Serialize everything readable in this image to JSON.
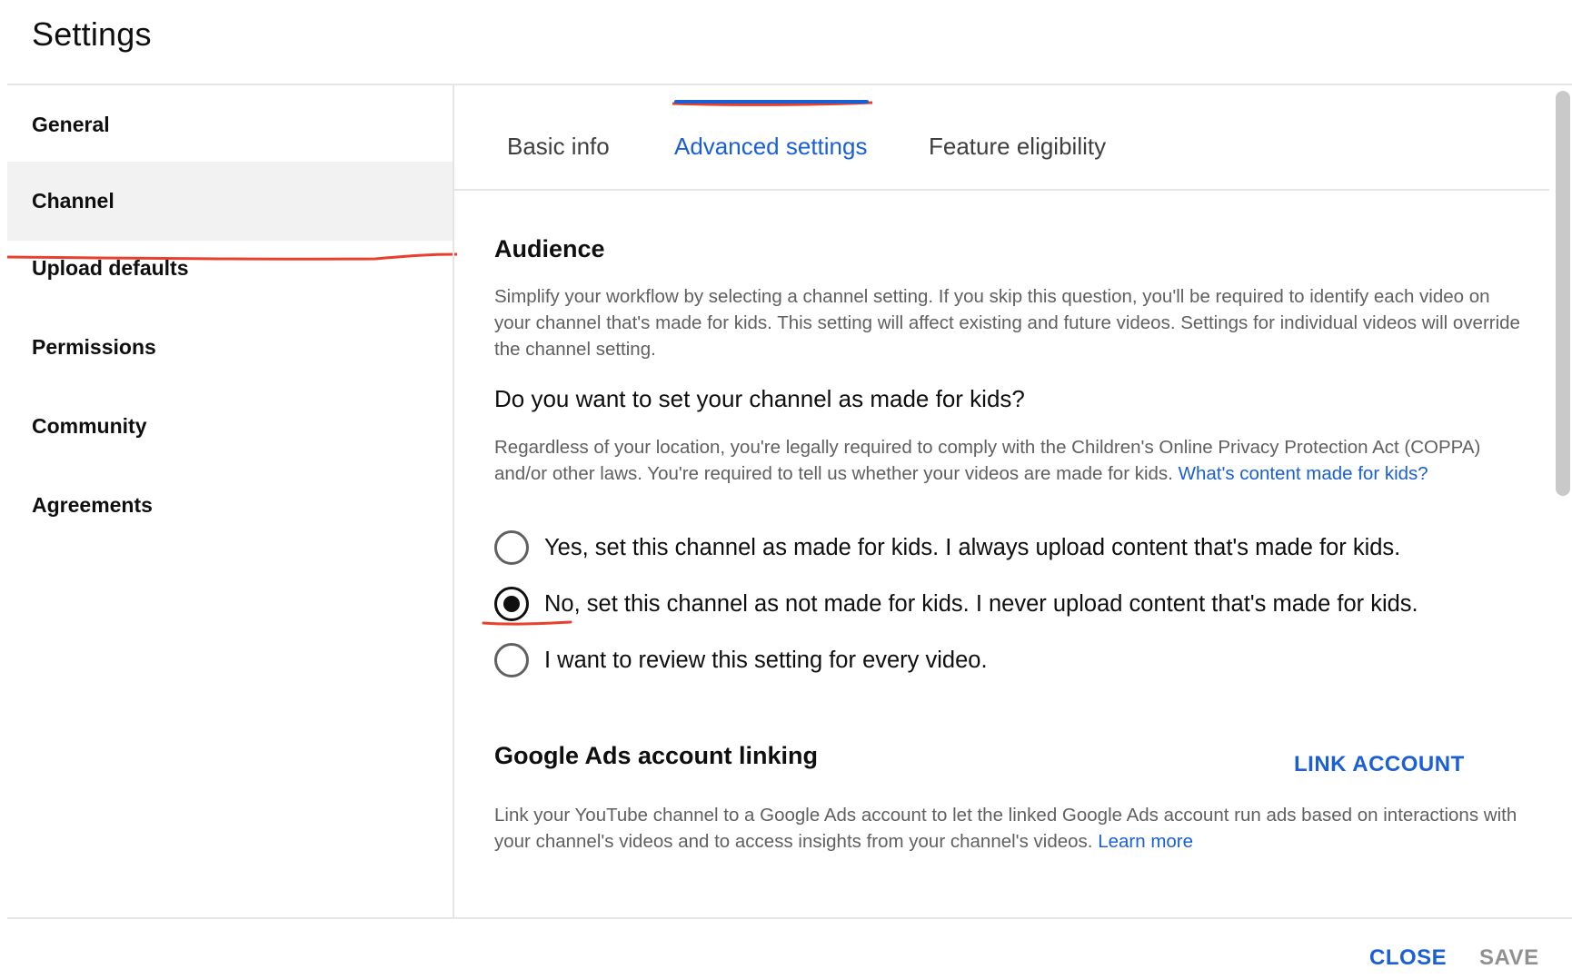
{
  "header": {
    "title": "Settings"
  },
  "sidebar": {
    "items": [
      {
        "label": "General",
        "active": false
      },
      {
        "label": "Channel",
        "active": true
      },
      {
        "label": "Upload defaults",
        "active": false
      },
      {
        "label": "Permissions",
        "active": false
      },
      {
        "label": "Community",
        "active": false
      },
      {
        "label": "Agreements",
        "active": false
      }
    ]
  },
  "tabs": [
    {
      "label": "Basic info",
      "active": false
    },
    {
      "label": "Advanced settings",
      "active": true
    },
    {
      "label": "Feature eligibility",
      "active": false
    }
  ],
  "audience": {
    "title": "Audience",
    "description": "Simplify your workflow by selecting a channel setting. If you skip this question, you'll be required to identify each video on your channel that's made for kids. This setting will affect existing and future videos. Settings for individual videos will override the channel setting.",
    "question": "Do you want to set your channel as made for kids?",
    "legal_text": "Regardless of your location, you're legally required to comply with the Children's Online Privacy Protection Act (COPPA) and/or other laws. You're required to tell us whether your videos are made for kids.",
    "legal_link": "What's content made for kids?",
    "options": [
      {
        "label": "Yes, set this channel as made for kids. I always upload content that's made for kids.",
        "checked": false
      },
      {
        "label": "No, set this channel as not made for kids. I never upload content that's made for kids.",
        "checked": true
      },
      {
        "label": "I want to review this setting for every video.",
        "checked": false
      }
    ]
  },
  "ads": {
    "title": "Google Ads account linking",
    "link_button": "LINK ACCOUNT",
    "description": "Link your YouTube channel to a Google Ads account to let the linked Google Ads account run ads based on interactions with your channel's videos and to access insights from your channel's videos.",
    "learn_more": "Learn more"
  },
  "footer": {
    "close_label": "CLOSE",
    "save_label": "SAVE"
  },
  "colors": {
    "accent": "#1a5fd6",
    "annotation": "#e8402a",
    "active_bg": "#f2f2f2",
    "disabled": "#909090"
  }
}
